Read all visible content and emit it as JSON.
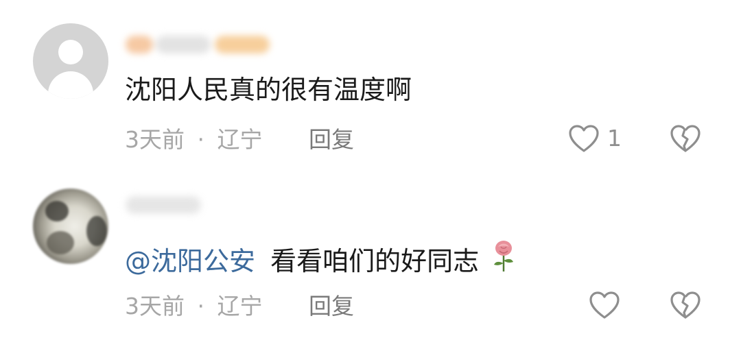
{
  "comments": [
    {
      "text": "沈阳人民真的很有温度啊",
      "time": "3天前",
      "separator": "·",
      "location": "辽宁",
      "reply_label": "回复",
      "likes": "1",
      "avatar": "default-avatar-icon"
    },
    {
      "mention": "@沈阳公安",
      "text": "看看咱们的好同志",
      "emoji": "rose-icon",
      "time": "3天前",
      "separator": "·",
      "location": "辽宁",
      "reply_label": "回复",
      "likes": "",
      "avatar": "photo-avatar"
    }
  ],
  "colors": {
    "text": "#1a1a1a",
    "meta": "#a6a6a6",
    "reply": "#7a7a7a",
    "mention": "#3c6a9c",
    "icon": "#8e8e8e"
  }
}
